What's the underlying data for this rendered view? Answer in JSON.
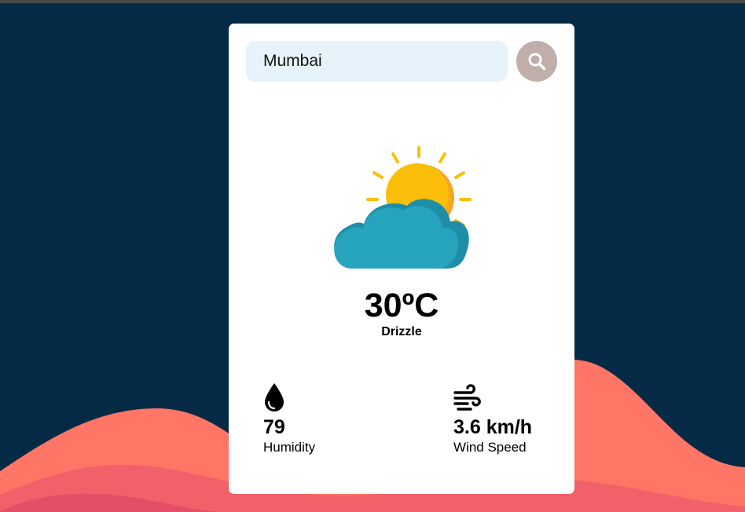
{
  "search": {
    "value": "Mumbai",
    "button_icon": "search-icon"
  },
  "weather": {
    "icon": "sun-behind-cloud-icon",
    "temperature": "30ºC",
    "condition": "Drizzle"
  },
  "stats": {
    "humidity": {
      "icon": "water-drop-icon",
      "value": "79",
      "label": "Humidity"
    },
    "wind": {
      "icon": "wind-icon",
      "value": "3.6 km/h",
      "label": "Wind Speed"
    }
  },
  "colors": {
    "background": "#052a45",
    "card": "#ffffff",
    "search_field": "#e6f3fa",
    "search_button": "#c0aeab",
    "wave_light": "#ff7566",
    "wave_mid": "#f2606a",
    "wave_dark": "#e54e67",
    "sun": "#fbbf0b",
    "cloud": "#27a4bd"
  }
}
